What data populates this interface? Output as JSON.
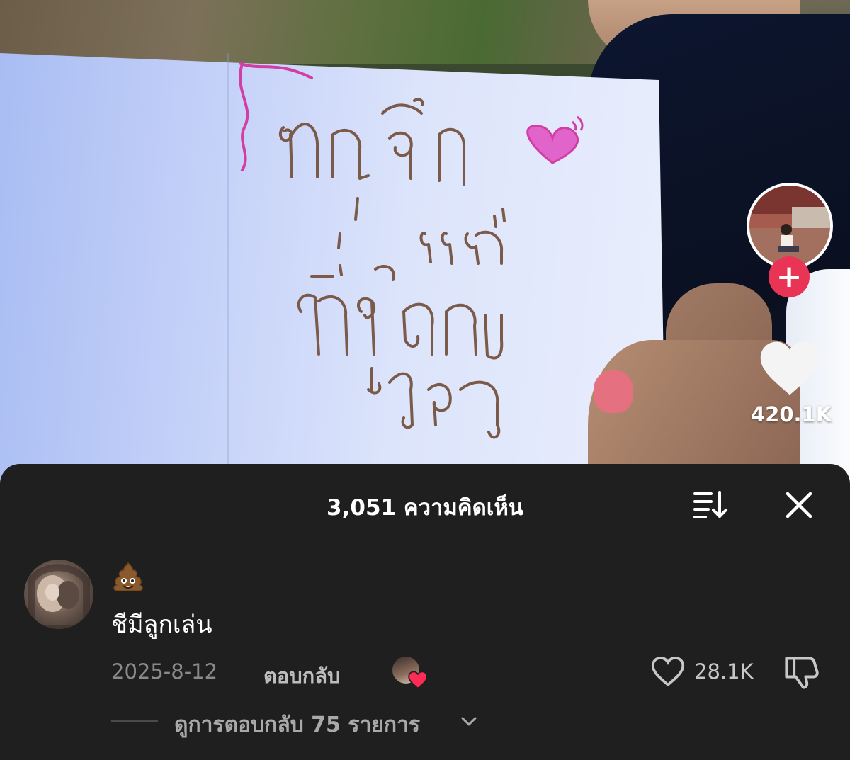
{
  "video": {
    "sign_text_lines": [
      "หนูรัก",
      "แม่",
      "ที่สุดใน",
      "โลก"
    ],
    "like_count": "420.1K"
  },
  "comments_sheet": {
    "title": "3,051 ความคิดเห็น",
    "comment": {
      "emoji": "💩",
      "text": "ชีมีลูกเล่น",
      "date": "2025-8-12",
      "reply_label": "ตอบกลับ",
      "like_count": "28.1K"
    },
    "view_replies": "ดูการตอบกลับ 75 รายการ"
  },
  "colors": {
    "accent_red": "#ea3455",
    "sheet_bg": "#1f1f1f"
  },
  "icons": [
    "sort-icon",
    "close-icon",
    "heart-icon",
    "dislike-icon",
    "chevron-down-icon",
    "plus-icon"
  ]
}
